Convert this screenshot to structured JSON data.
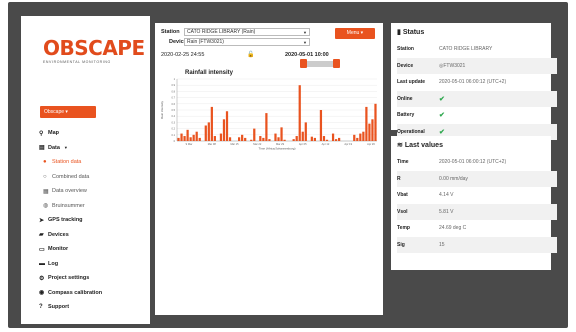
{
  "sidebar": {
    "logo_main": "OBSCAPE",
    "logo_sub": "ENVIRONMENTAL MONITORING",
    "dropdown_label": "Obscape",
    "nav": [
      {
        "label": "Map",
        "icon": "map-marker-icon"
      },
      {
        "label": "Data",
        "icon": "chart-icon"
      },
      {
        "label": "Station data",
        "icon": "location-icon",
        "sub": true,
        "active": true
      },
      {
        "label": "Combined data",
        "icon": "circle-icon",
        "sub": true
      },
      {
        "label": "Data overview",
        "icon": "grid-icon",
        "sub": true
      },
      {
        "label": "Bruinsummer",
        "icon": "user-circle-icon",
        "sub": true
      },
      {
        "label": "GPS tracking",
        "icon": "send-icon"
      },
      {
        "label": "Devices",
        "icon": "car-icon"
      },
      {
        "label": "Monitor",
        "icon": "monitor-icon"
      },
      {
        "label": "Log",
        "icon": "folder-icon"
      },
      {
        "label": "Project settings",
        "icon": "cogs-icon"
      },
      {
        "label": "Compass calibration",
        "icon": "compass-icon"
      },
      {
        "label": "Support",
        "icon": "question-icon"
      }
    ]
  },
  "main": {
    "station_label": "Station",
    "station_value": "CATO RIDGE LIBRARY (Rain)",
    "device_label": "Device",
    "device_value": "Rain (FTW3021)",
    "menu_label": "Menu",
    "date_start": "2020-02-25 24:55",
    "date_end": "2020-05-01 10:00"
  },
  "chart_data": {
    "type": "bar",
    "title": "Rainfall intensity",
    "ylabel": "Rain intensity",
    "xlabel": "Time (Africa/Johannesburg)",
    "ylim": [
      0,
      1
    ],
    "yticks": [
      "0",
      "0.1",
      "0.2",
      "0.3",
      "0.4",
      "0.5",
      "0.6",
      "0.7",
      "0.8",
      "0.9",
      "1"
    ],
    "xticks": [
      "9 Mar",
      "Mar 08",
      "Mar 15",
      "Mar 22",
      "Mar 29",
      "Apr 05",
      "Apr 12",
      "Apr 19",
      "Apr 26"
    ],
    "color": "#e9531f",
    "x": [
      1,
      2,
      3,
      4,
      5,
      6,
      7,
      8,
      9,
      10,
      11,
      12,
      13,
      14,
      15,
      16,
      17,
      18,
      19,
      20,
      21,
      22,
      23,
      24,
      25,
      26,
      27,
      28,
      29,
      30,
      31,
      32,
      33,
      34,
      35,
      36,
      37,
      38,
      39,
      40,
      41,
      42,
      43,
      44,
      45,
      46,
      47,
      48,
      49,
      50,
      51,
      52,
      53,
      54,
      55,
      56,
      57,
      58,
      59,
      60,
      61,
      62,
      63,
      64,
      65,
      66
    ],
    "values": [
      0.05,
      0.12,
      0.08,
      0.18,
      0.06,
      0.1,
      0.15,
      0.05,
      0,
      0.25,
      0.3,
      0.55,
      0.08,
      0,
      0.12,
      0.35,
      0.48,
      0.06,
      0,
      0,
      0.06,
      0.1,
      0.05,
      0,
      0.02,
      0.2,
      0,
      0.08,
      0.05,
      0.45,
      0.03,
      0,
      0.12,
      0.06,
      0.22,
      0.02,
      0,
      0,
      0.03,
      0.08,
      0.9,
      0.15,
      0.3,
      0,
      0.07,
      0.05,
      0,
      0.5,
      0.08,
      0.02,
      0,
      0.12,
      0.03,
      0.05,
      0,
      0,
      0,
      0,
      0.1,
      0.05,
      0.12,
      0.15,
      0.55,
      0.28,
      0.35,
      0.6
    ]
  },
  "status": {
    "title": "Status",
    "rows": [
      {
        "k": "Station",
        "v": "CATO RIDGE LIBRARY"
      },
      {
        "k": "Device",
        "v": "FTW3021"
      },
      {
        "k": "Last update",
        "v": "2020-05-01 06:00:12 (UTC+2)"
      },
      {
        "k": "Online",
        "v": "✔"
      },
      {
        "k": "Battery",
        "v": "✔"
      },
      {
        "k": "Operational",
        "v": "✔"
      }
    ]
  },
  "last_values": {
    "title": "Last values",
    "rows": [
      {
        "k": "Time",
        "v": "2020-05-01 06:00:12 (UTC+2)"
      },
      {
        "k": "R",
        "v": "0.00 mm/day"
      },
      {
        "k": "Vbat",
        "v": "4.14 V"
      },
      {
        "k": "Vsol",
        "v": "5.81 V"
      },
      {
        "k": "Temp",
        "v": "24.69 deg C"
      },
      {
        "k": "Sig",
        "v": "15"
      }
    ]
  }
}
